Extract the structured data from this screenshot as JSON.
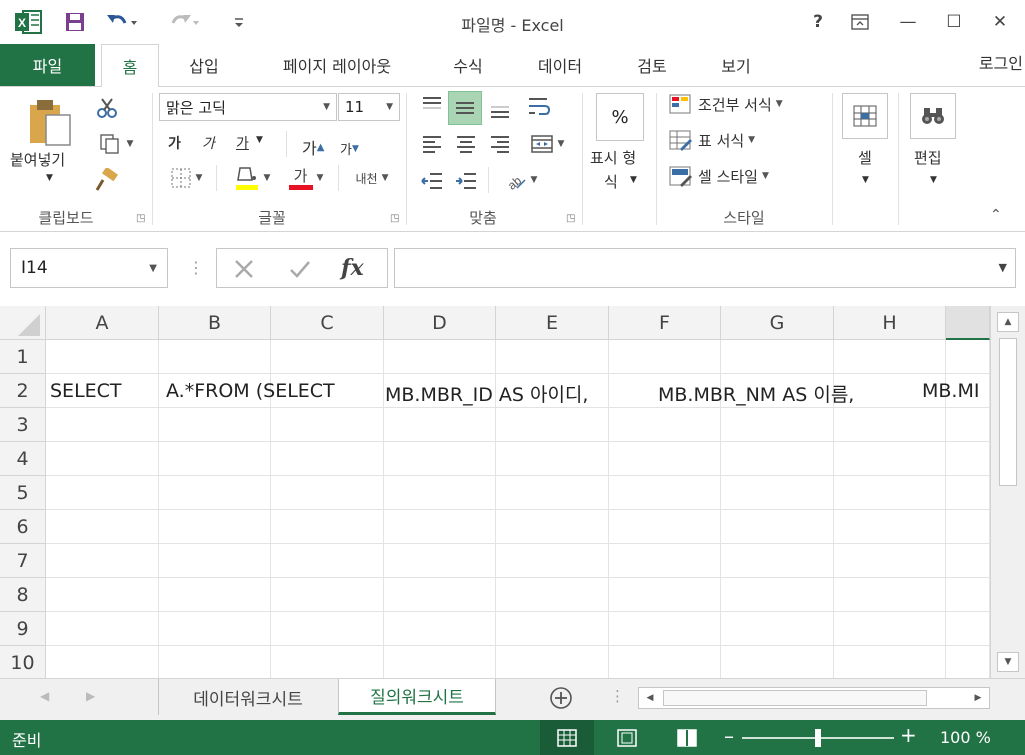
{
  "title": "파일명 - Excel",
  "window": {
    "help": "?",
    "minimize": "—",
    "maximize": "☐",
    "close": "✕"
  },
  "tabs": [
    {
      "label": "파일"
    },
    {
      "label": "홈"
    },
    {
      "label": "삽입"
    },
    {
      "label": "페이지 레이아웃"
    },
    {
      "label": "수식"
    },
    {
      "label": "데이터"
    },
    {
      "label": "검토"
    },
    {
      "label": "보기"
    }
  ],
  "login": "로그인",
  "ribbon": {
    "clipboard": {
      "paste_label": "붙여넣기",
      "group": "클립보드"
    },
    "font": {
      "name": "맑은 고딕",
      "size": "11",
      "bold": "가",
      "italic": "가",
      "underline": "가",
      "grow": "가",
      "shrink": "가",
      "font_color": "가",
      "phonetic": "내천",
      "group": "글꼴"
    },
    "alignment": {
      "group": "맞춤"
    },
    "number": {
      "label_line1": "표시 형",
      "label_line2": "식",
      "icon": "%"
    },
    "styles": {
      "conditional": "조건부 서식",
      "table": "표 서식",
      "cell": "셀 스타일",
      "group": "스타일"
    },
    "cells": {
      "label": "셀"
    },
    "editing": {
      "label": "편집"
    }
  },
  "formula_bar": {
    "name_box": "I14",
    "fx": "fx",
    "value": ""
  },
  "grid": {
    "columns": [
      "A",
      "B",
      "C",
      "D",
      "E",
      "F",
      "G",
      "H"
    ],
    "rows": [
      "1",
      "2",
      "3",
      "4",
      "5",
      "6",
      "7",
      "8",
      "9",
      "10"
    ],
    "row2_texts": [
      "SELECT",
      "A.*FROM (SELECT",
      "MB.MBR_ID AS 아이디,",
      "MB.MBR_NM AS 이름,",
      "MB.MI"
    ]
  },
  "sheets": [
    "데이터워크시트",
    "질의워크시트"
  ],
  "status": {
    "ready": "준비",
    "zoom": "100 %"
  },
  "colors": {
    "accent": "#217346",
    "highlight": "#a9d5b5",
    "yellow": "#ffff00",
    "red": "#e81123"
  }
}
